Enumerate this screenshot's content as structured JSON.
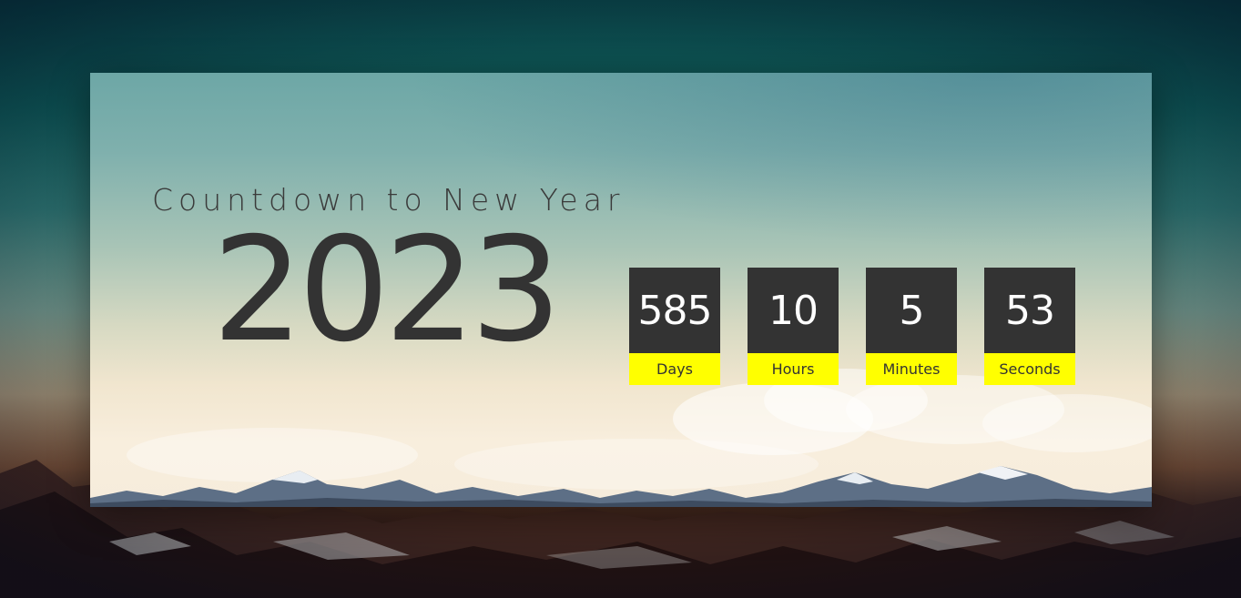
{
  "heading": {
    "subtitle": "Countdown to New Year",
    "year": "2023"
  },
  "countdown": [
    {
      "value": "585",
      "label": "Days"
    },
    {
      "value": "10",
      "label": "Hours"
    },
    {
      "value": "5",
      "label": "Minutes"
    },
    {
      "value": "53",
      "label": "Seconds"
    }
  ],
  "colors": {
    "counter_box": "#333333",
    "counter_label_bg": "#ffff00",
    "text_dark": "#333333"
  }
}
